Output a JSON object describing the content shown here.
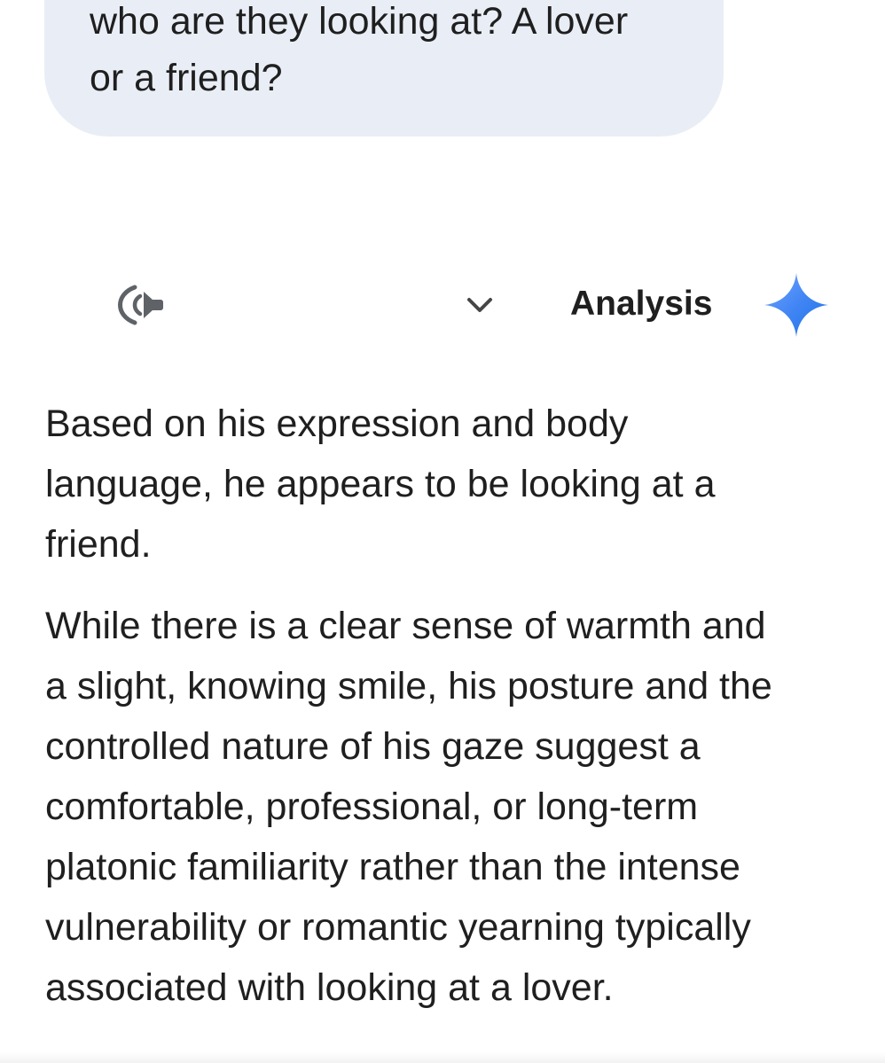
{
  "user_prompt": {
    "lines": [
      "who are they looking at? A lover",
      "or a friend?"
    ]
  },
  "response_header": {
    "speaker_icon": "speaker-wave-icon",
    "chevron_icon": "chevron-down-icon",
    "label": "Analysis",
    "sparkle_icon": "gemini-sparkle-icon",
    "sparkle_colors": [
      "#4285f4",
      "#1a73e8",
      "#6fa8ff"
    ]
  },
  "response": {
    "paragraphs": [
      {
        "lines": [
          "Based on his expression and body",
          "language, he appears to be looking at a",
          "friend."
        ]
      },
      {
        "lines": [
          "While there is a clear sense of warmth and",
          "a slight, knowing smile, his posture and the",
          "controlled nature of his gaze suggest a",
          "comfortable, professional, or long-term",
          "platonic familiarity rather than the intense",
          "vulnerability or romantic yearning typically",
          "associated with looking at a lover."
        ]
      }
    ]
  }
}
